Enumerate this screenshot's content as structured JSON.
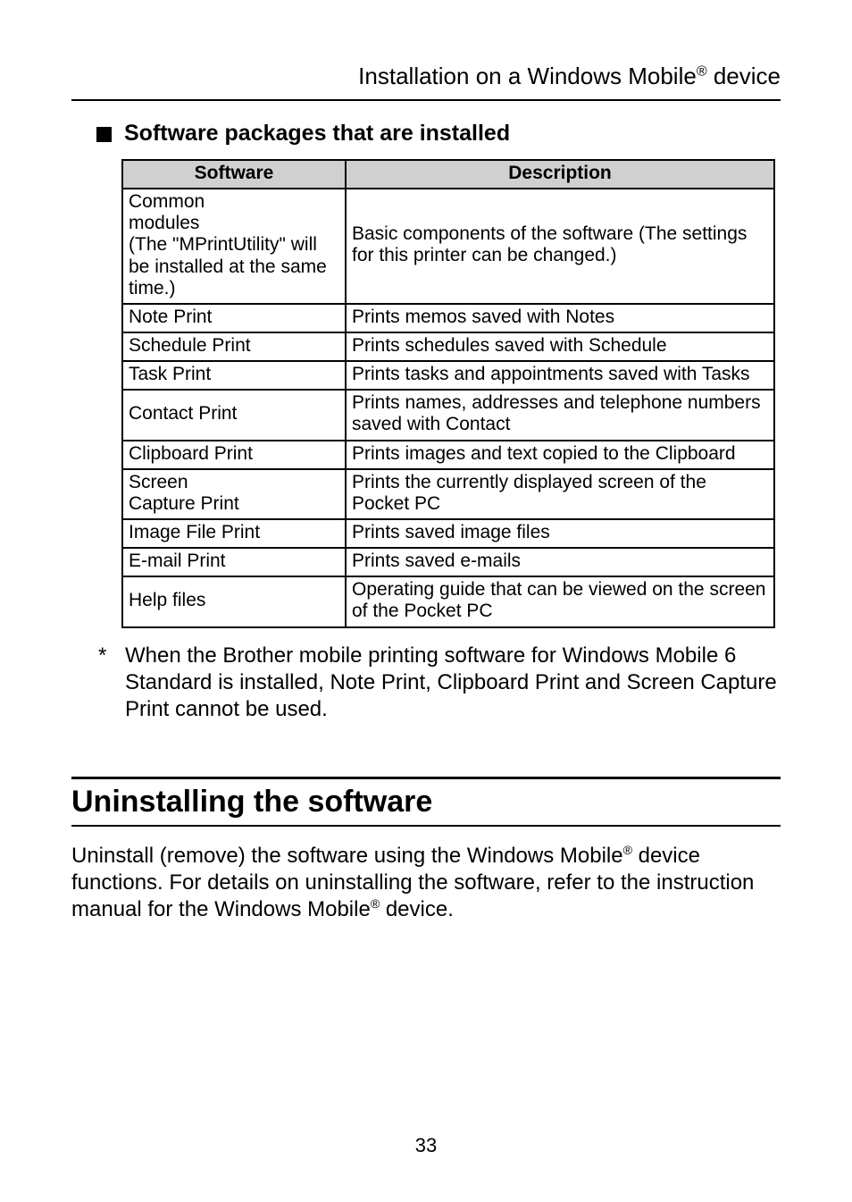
{
  "header": {
    "prefix": "Installation on a Windows Mobile",
    "sup": "®",
    "suffix": " device"
  },
  "subheading": "Software packages that are installed",
  "table": {
    "headers": {
      "software": "Software",
      "description": "Description"
    },
    "rows": [
      {
        "software": "Common\nmodules\n(The \"MPrintUtility\" will be installed at the same time.)",
        "description": "Basic components of the software (The settings for this printer can be changed.)"
      },
      {
        "software": "Note Print",
        "description": "Prints memos saved with Notes"
      },
      {
        "software": "Schedule Print",
        "description": "Prints schedules saved with Schedule"
      },
      {
        "software": "Task Print",
        "description": "Prints tasks and appointments saved with Tasks"
      },
      {
        "software": "Contact Print",
        "description": "Prints names, addresses and telephone numbers saved with Contact"
      },
      {
        "software": "Clipboard Print",
        "description": "Prints images and text copied to the Clipboard"
      },
      {
        "software": "Screen\nCapture Print",
        "description": "Prints the currently displayed screen of the Pocket PC"
      },
      {
        "software": "Image File Print",
        "description": "Prints saved image files"
      },
      {
        "software": "E-mail Print",
        "description": "Prints saved e-mails"
      },
      {
        "software": "Help files",
        "description": "Operating guide that can be viewed on the screen of the Pocket PC"
      }
    ]
  },
  "footnote": {
    "marker": "*",
    "text": "When the Brother mobile printing software for Windows Mobile 6 Standard is installed, Note Print, Clipboard Print and Screen Capture Print cannot be used."
  },
  "section": {
    "title": "Uninstalling the software",
    "para_part1": "Uninstall (remove) the software using the Windows Mobile",
    "para_sup1": "®",
    "para_part2": " device functions. For details on uninstalling the software, refer to the instruction manual for the Windows Mobile",
    "para_sup2": "®",
    "para_part3": " device."
  },
  "page_number": "33"
}
